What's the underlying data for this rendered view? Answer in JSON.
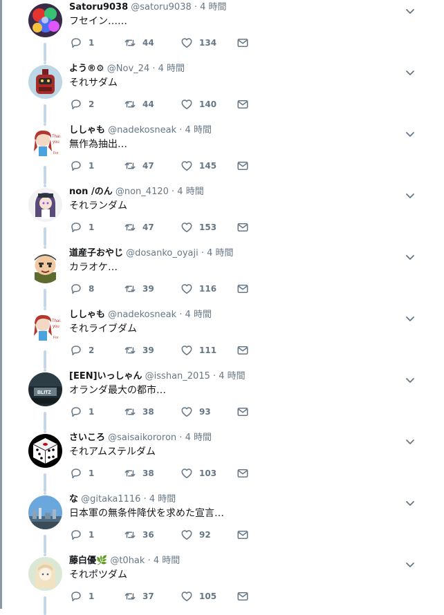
{
  "theme": {
    "text": "#14171a",
    "muted": "#657786",
    "thread_line": "#c4d7ea"
  },
  "tweets": [
    {
      "avatar": "colorful-spheres",
      "name": "Satoru9038",
      "handle": "@satoru9038",
      "time": "4 時間",
      "text": "フセイン……",
      "replies": "1",
      "retweets": "44",
      "likes": "134"
    },
    {
      "avatar": "red-robot",
      "name": "よう®⚙",
      "handle": "@Nov_24",
      "time": "4 時間",
      "text": "それサダム",
      "replies": "2",
      "retweets": "44",
      "likes": "140"
    },
    {
      "avatar": "thank-you-girl",
      "name": "ししゃも",
      "handle": "@nadekosneak",
      "time": "4 時間",
      "text": "無作為抽出…",
      "replies": "1",
      "retweets": "47",
      "likes": "145"
    },
    {
      "avatar": "anime-girl",
      "name": "non /のん",
      "handle": "@non_4120",
      "time": "4 時間",
      "text": "それランダム",
      "replies": "1",
      "retweets": "47",
      "likes": "153"
    },
    {
      "avatar": "old-man",
      "name": "道産子おやじ",
      "handle": "@dosanko_oyaji",
      "time": "4 時間",
      "text": "カラオケ…",
      "replies": "8",
      "retweets": "39",
      "likes": "116"
    },
    {
      "avatar": "thank-you-girl",
      "name": "ししゃも",
      "handle": "@nadekosneak",
      "time": "4 時間",
      "text": "それライブダム",
      "replies": "2",
      "retweets": "39",
      "likes": "111"
    },
    {
      "avatar": "dark-game-logo",
      "name": "[EEN]いっしゃん",
      "handle": "@isshan_2015",
      "time": "4 時間",
      "text": "オランダ最大の都市…",
      "replies": "1",
      "retweets": "38",
      "likes": "93"
    },
    {
      "avatar": "dice",
      "name": "さいころ",
      "handle": "@saisaikororon",
      "time": "4 時間",
      "text": "それアムステルダム",
      "replies": "1",
      "retweets": "38",
      "likes": "103"
    },
    {
      "avatar": "city-sky",
      "name": "な",
      "handle": "@gitaka1116",
      "time": "4 時間",
      "text": "日本軍の無条件降伏を求めた宣言…",
      "replies": "1",
      "retweets": "36",
      "likes": "92"
    },
    {
      "avatar": "sketch-girl",
      "name": "藤白優🌿",
      "handle": "@t0hak",
      "time": "4 時間",
      "text": "それポツダム",
      "replies": "1",
      "retweets": "37",
      "likes": "105"
    }
  ]
}
